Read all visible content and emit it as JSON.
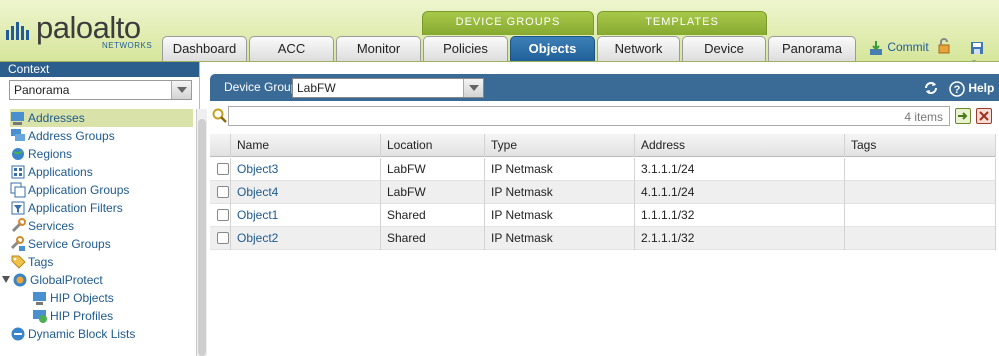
{
  "brand": {
    "name": "paloalto",
    "sub": "NETWORKS"
  },
  "groups": {
    "device_groups": "DEVICE GROUPS",
    "templates": "TEMPLATES"
  },
  "tabs": [
    {
      "label": "Dashboard"
    },
    {
      "label": "ACC"
    },
    {
      "label": "Monitor"
    },
    {
      "label": "Policies"
    },
    {
      "label": "Objects"
    },
    {
      "label": "Network"
    },
    {
      "label": "Device"
    },
    {
      "label": "Panorama"
    }
  ],
  "active_tab": "Objects",
  "header_actions": {
    "commit": "Commit",
    "save": "Sa"
  },
  "context": {
    "label": "Context",
    "selected": "Panorama"
  },
  "tree": [
    {
      "label": "Addresses",
      "icon": "addresses-icon",
      "selected": true
    },
    {
      "label": "Address Groups",
      "icon": "address-groups-icon"
    },
    {
      "label": "Regions",
      "icon": "regions-icon"
    },
    {
      "label": "Applications",
      "icon": "applications-icon"
    },
    {
      "label": "Application Groups",
      "icon": "application-groups-icon"
    },
    {
      "label": "Application Filters",
      "icon": "application-filters-icon"
    },
    {
      "label": "Services",
      "icon": "services-icon"
    },
    {
      "label": "Service Groups",
      "icon": "service-groups-icon"
    },
    {
      "label": "Tags",
      "icon": "tags-icon"
    },
    {
      "label": "GlobalProtect",
      "icon": "globalprotect-icon"
    },
    {
      "label": "HIP Objects",
      "icon": "hip-objects-icon"
    },
    {
      "label": "HIP Profiles",
      "icon": "hip-profiles-icon"
    },
    {
      "label": "Dynamic Block Lists",
      "icon": "dynamic-block-lists-icon"
    }
  ],
  "device_group": {
    "label": "Device Group",
    "selected": "LabFW"
  },
  "help_label": "Help",
  "search": {
    "value": "",
    "count": "4 items"
  },
  "table": {
    "headers": [
      "Name",
      "Location",
      "Type",
      "Address",
      "Tags"
    ],
    "rows": [
      {
        "name": "Object3",
        "location": "LabFW",
        "type": "IP Netmask",
        "address": "3.1.1.1/24",
        "tags": ""
      },
      {
        "name": "Object4",
        "location": "LabFW",
        "type": "IP Netmask",
        "address": "4.1.1.1/24",
        "tags": ""
      },
      {
        "name": "Object1",
        "location": "Shared",
        "type": "IP Netmask",
        "address": "1.1.1.1/32",
        "tags": ""
      },
      {
        "name": "Object2",
        "location": "Shared",
        "type": "IP Netmask",
        "address": "2.1.1.1/32",
        "tags": ""
      }
    ]
  },
  "colors": {
    "accent_blue": "#2b5e8c",
    "header_green": "#d6e69b",
    "tab_group_green": "#96b83a",
    "link": "#1e5a8e"
  }
}
